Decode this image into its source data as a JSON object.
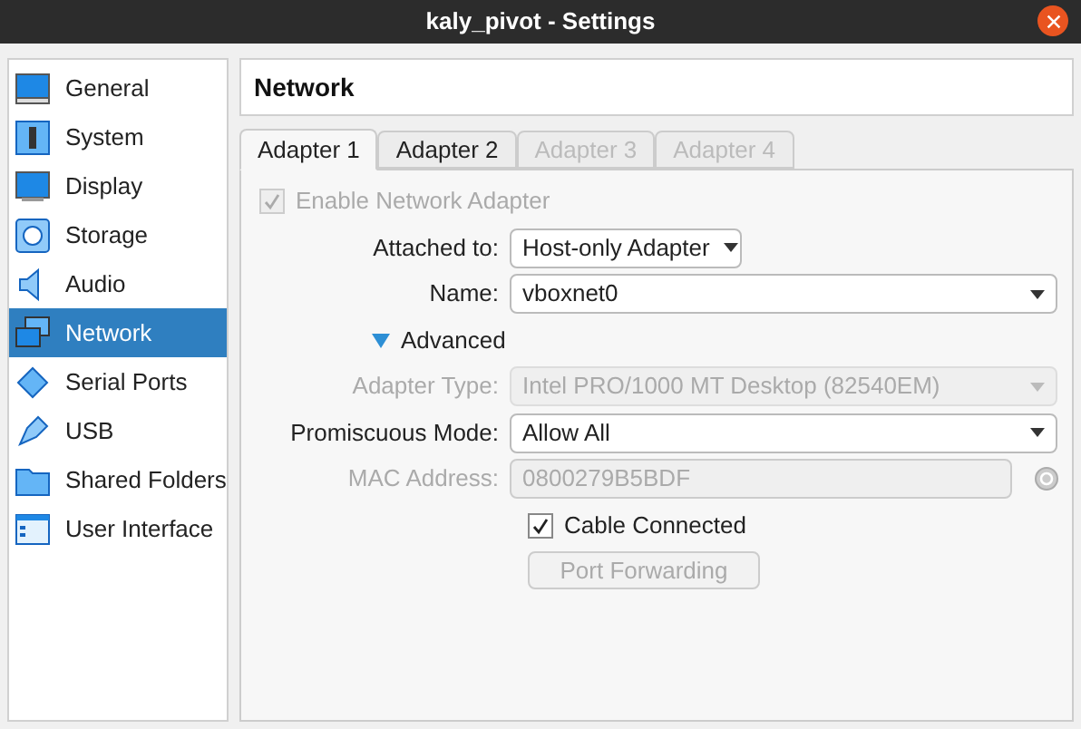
{
  "window": {
    "title": "kaly_pivot - Settings"
  },
  "sidebar": {
    "items": [
      {
        "label": "General",
        "selected": false
      },
      {
        "label": "System",
        "selected": false
      },
      {
        "label": "Display",
        "selected": false
      },
      {
        "label": "Storage",
        "selected": false
      },
      {
        "label": "Audio",
        "selected": false
      },
      {
        "label": "Network",
        "selected": true
      },
      {
        "label": "Serial Ports",
        "selected": false
      },
      {
        "label": "USB",
        "selected": false
      },
      {
        "label": "Shared Folders",
        "selected": false
      },
      {
        "label": "User Interface",
        "selected": false
      }
    ]
  },
  "page_title": "Network",
  "tabs": [
    {
      "label": "Adapter 1",
      "selected": true,
      "disabled": false
    },
    {
      "label": "Adapter 2",
      "selected": false,
      "disabled": false
    },
    {
      "label": "Adapter 3",
      "selected": false,
      "disabled": true
    },
    {
      "label": "Adapter 4",
      "selected": false,
      "disabled": true
    }
  ],
  "rows": [
    {
      "kind": "checkbox",
      "label": "Enable Network Adapter",
      "checked": true,
      "disabled": true
    },
    {
      "kind": "combo",
      "label": "Attached to:",
      "value": "Host-only Adapter",
      "disabled": false,
      "wide": false
    },
    {
      "kind": "combo",
      "label": "Name:",
      "value": "vboxnet0",
      "disabled": false,
      "wide": true
    },
    {
      "kind": "expander",
      "label": "Advanced",
      "expanded": true
    },
    {
      "kind": "combo",
      "label": "Adapter Type:",
      "value": "Intel PRO/1000 MT Desktop (82540EM)",
      "disabled": true,
      "wide": true
    },
    {
      "kind": "combo",
      "label": "Promiscuous Mode:",
      "value": "Allow All",
      "disabled": false,
      "wide": true
    },
    {
      "kind": "field",
      "label": "MAC Address:",
      "value": "0800279B5BDF",
      "disabled": true
    },
    {
      "kind": "checkbox",
      "label": "Cable Connected",
      "checked": true,
      "disabled": false
    },
    {
      "kind": "button",
      "label": "Port Forwarding",
      "disabled": true
    }
  ]
}
